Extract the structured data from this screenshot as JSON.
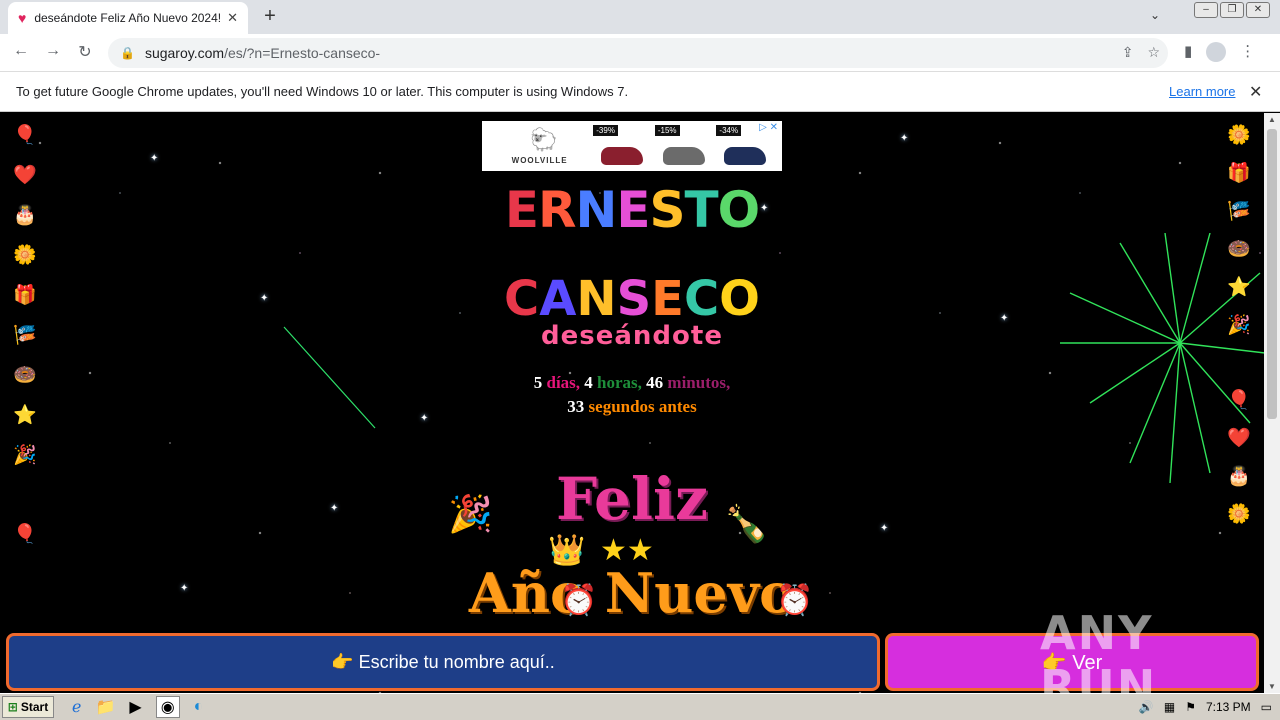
{
  "browser": {
    "tab_title": "deseándote Feliz Año Nuevo 2024!",
    "url_host": "sugaroy.com",
    "url_path": "/es/?n=Ernesto-canseco-",
    "infobar_message": "To get future Google Chrome updates, you'll need Windows 10 or later. This computer is using Windows 7.",
    "learn_more": "Learn more"
  },
  "ad": {
    "brand": "WOOLVILLE",
    "discounts": [
      "-39%",
      "-15%",
      "-34%"
    ]
  },
  "greeting": {
    "first_name": "ERNESTO",
    "last_name": "CANSECO",
    "wish": "deseándote",
    "countdown": {
      "days": "5",
      "days_label": "días,",
      "hours": "4",
      "hours_label": "horas,",
      "minutes": "46",
      "minutes_label": "minutos,",
      "seconds": "33",
      "seconds_label": "segundos antes"
    },
    "feliz": "Feliz",
    "anio_nuevo": "Año Nuevo"
  },
  "actions": {
    "name_input": "👉 Escribe tu nombre aquí..",
    "ver_button": "👉 Ver"
  },
  "watermark": "ANY RUN",
  "taskbar": {
    "start": "Start",
    "time": "7:13 PM"
  },
  "colors": {
    "name_bar": "#1e3e88",
    "ver_button": "#d62ede",
    "border": "#f06a2e"
  }
}
